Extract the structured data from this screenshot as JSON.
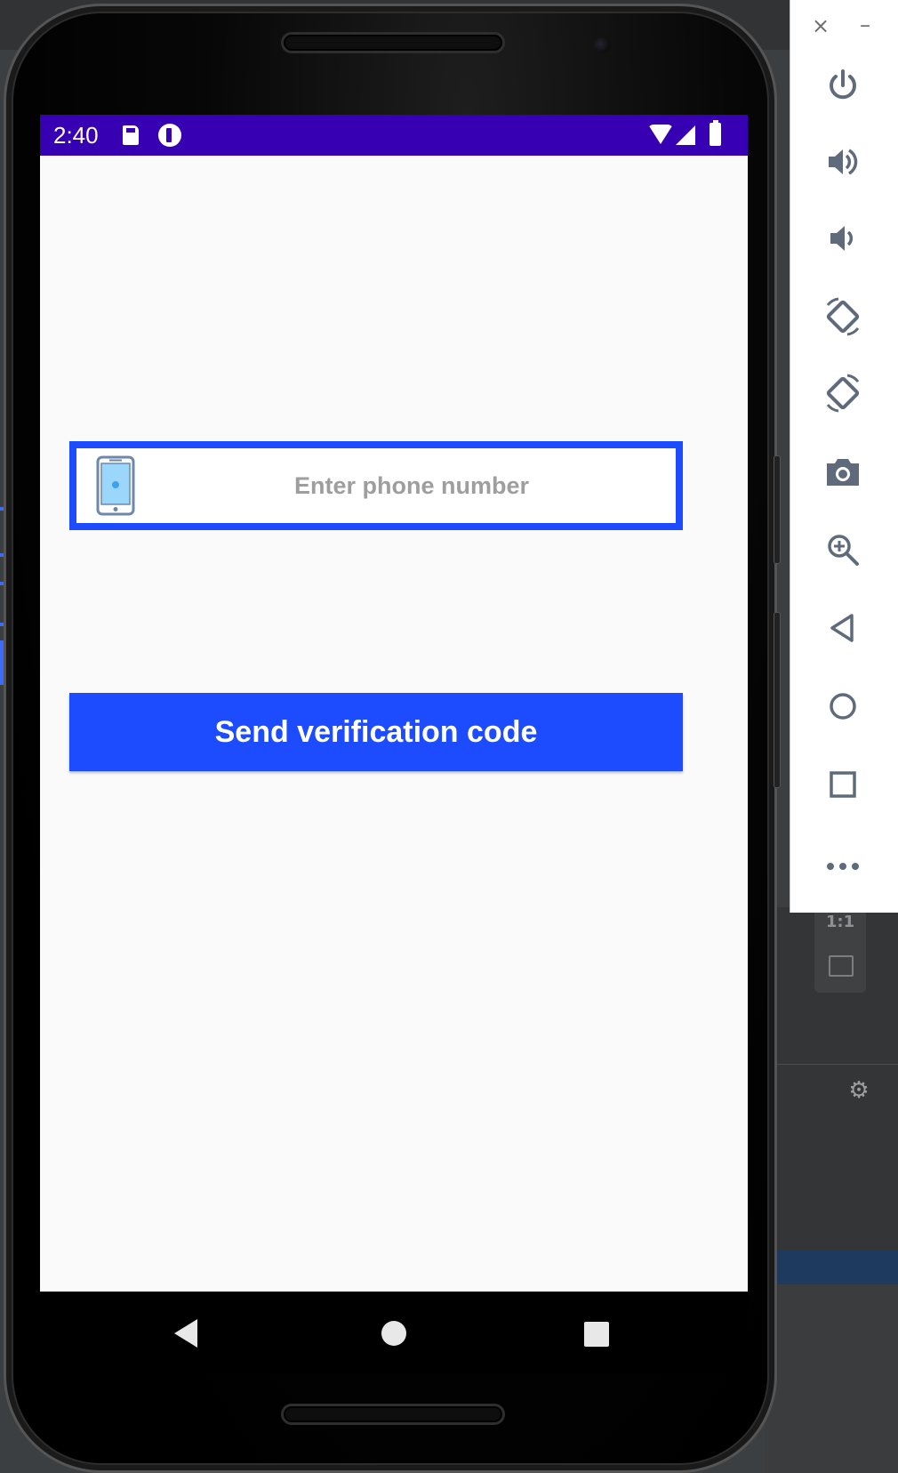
{
  "status_bar": {
    "time": "2:40",
    "background_color": "#3700b3",
    "icons": [
      "sd-card-icon",
      "app-notification-icon",
      "wifi-icon",
      "signal-icon",
      "battery-icon"
    ]
  },
  "login": {
    "phone_placeholder": "Enter phone number",
    "phone_value": "",
    "phone_icon": "smartphone-icon",
    "send_button_label": "Send verification code",
    "accent_color": "#1d4cff"
  },
  "nav_bar": {
    "buttons": [
      "back",
      "home",
      "recents"
    ]
  },
  "emulator_toolbar": {
    "close_label": "×",
    "minimize_label": "–",
    "buttons": [
      {
        "name": "power",
        "icon": "power-icon"
      },
      {
        "name": "volume-up",
        "icon": "volume-up-icon"
      },
      {
        "name": "volume-down",
        "icon": "volume-down-icon"
      },
      {
        "name": "rotate-left",
        "icon": "rotate-left-icon"
      },
      {
        "name": "rotate-right",
        "icon": "rotate-right-icon"
      },
      {
        "name": "screenshot",
        "icon": "camera-icon"
      },
      {
        "name": "zoom",
        "icon": "zoom-in-icon"
      },
      {
        "name": "back",
        "icon": "back-triangle-icon"
      },
      {
        "name": "home",
        "icon": "home-circle-icon"
      },
      {
        "name": "overview",
        "icon": "overview-square-icon"
      },
      {
        "name": "more",
        "icon": "more-dots-icon"
      }
    ]
  },
  "ide": {
    "ratio_label": "1:1",
    "settings_icon": "gear-icon"
  }
}
